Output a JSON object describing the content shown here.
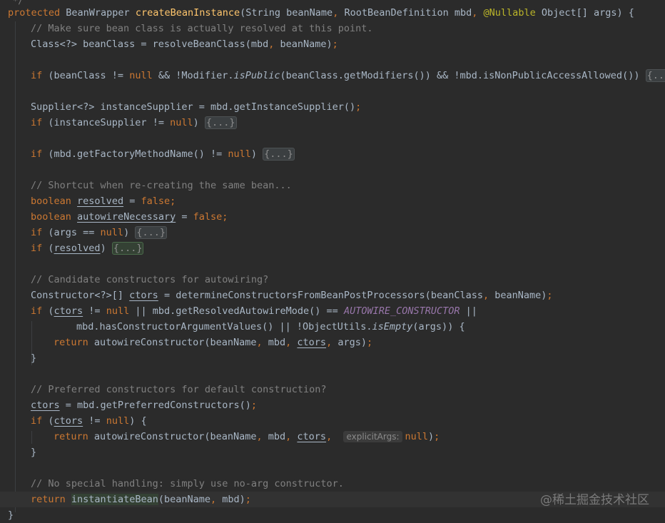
{
  "top_stub": "*/",
  "lines": [
    {
      "id": "signature",
      "indent": 0,
      "current": false,
      "segs": [
        {
          "t": "protected",
          "c": "kw"
        },
        {
          "t": " BeanWrapper "
        },
        {
          "t": "createBeanInstance",
          "c": "fn"
        },
        {
          "t": "(String beanName"
        },
        {
          "t": ",",
          "c": "kw"
        },
        {
          "t": " RootBeanDefinition mbd"
        },
        {
          "t": ",",
          "c": "kw"
        },
        {
          "t": " "
        },
        {
          "t": "@Nullable",
          "c": "an"
        },
        {
          "t": " Object[] args) {"
        }
      ]
    },
    {
      "id": "comment-resolve",
      "indent": 43,
      "segs": [
        {
          "t": "// Make sure bean class is actually resolved at this point.",
          "c": "cm"
        }
      ]
    },
    {
      "id": "bean-class",
      "indent": 43,
      "segs": [
        {
          "t": "Class<?> beanClass = resolveBeanClass(mbd"
        },
        {
          "t": ",",
          "c": "kw"
        },
        {
          "t": " beanName)"
        },
        {
          "t": ";",
          "c": "kw"
        }
      ]
    },
    {
      "id": "blank-1",
      "indent": 0,
      "segs": []
    },
    {
      "id": "if-public",
      "indent": 43,
      "segs": [
        {
          "t": "if",
          "c": "kw"
        },
        {
          "t": " (beanClass != "
        },
        {
          "t": "null",
          "c": "kw"
        },
        {
          "t": " && !Modifier."
        },
        {
          "t": "isPublic",
          "c": "it"
        },
        {
          "t": "(beanClass.getModifiers()) && !mbd.isNonPublicAccessAllowed()) "
        },
        {
          "t": "{...}",
          "c": "fold"
        }
      ]
    },
    {
      "id": "blank-2",
      "indent": 0,
      "segs": []
    },
    {
      "id": "supplier",
      "indent": 43,
      "segs": [
        {
          "t": "Supplier<?> instanceSupplier = mbd.getInstanceSupplier()"
        },
        {
          "t": ";",
          "c": "kw"
        }
      ]
    },
    {
      "id": "if-supplier",
      "indent": 43,
      "segs": [
        {
          "t": "if",
          "c": "kw"
        },
        {
          "t": " (instanceSupplier != "
        },
        {
          "t": "null",
          "c": "kw"
        },
        {
          "t": ") "
        },
        {
          "t": "{...}",
          "c": "fold"
        }
      ]
    },
    {
      "id": "blank-3",
      "indent": 0,
      "segs": []
    },
    {
      "id": "if-factory",
      "indent": 43,
      "segs": [
        {
          "t": "if",
          "c": "kw"
        },
        {
          "t": " (mbd.getFactoryMethodName() != "
        },
        {
          "t": "null",
          "c": "kw"
        },
        {
          "t": ") "
        },
        {
          "t": "{...}",
          "c": "fold"
        }
      ]
    },
    {
      "id": "blank-4",
      "indent": 0,
      "segs": []
    },
    {
      "id": "comment-shortcut",
      "indent": 43,
      "segs": [
        {
          "t": "// Shortcut when re-creating the same bean...",
          "c": "cm"
        }
      ]
    },
    {
      "id": "resolved-decl",
      "indent": 43,
      "segs": [
        {
          "t": "boolean",
          "c": "kw"
        },
        {
          "t": " "
        },
        {
          "t": "resolved",
          "c": "ul"
        },
        {
          "t": " = "
        },
        {
          "t": "false",
          "c": "kw"
        },
        {
          "t": ";",
          "c": "kw"
        }
      ]
    },
    {
      "id": "autowire-decl",
      "indent": 43,
      "segs": [
        {
          "t": "boolean",
          "c": "kw"
        },
        {
          "t": " "
        },
        {
          "t": "autowireNecessary",
          "c": "ul"
        },
        {
          "t": " = "
        },
        {
          "t": "false",
          "c": "kw"
        },
        {
          "t": ";",
          "c": "kw"
        }
      ]
    },
    {
      "id": "if-args",
      "indent": 43,
      "segs": [
        {
          "t": "if",
          "c": "kw"
        },
        {
          "t": " (args == "
        },
        {
          "t": "null",
          "c": "kw"
        },
        {
          "t": ") "
        },
        {
          "t": "{...}",
          "c": "fold"
        }
      ]
    },
    {
      "id": "if-resolved",
      "indent": 43,
      "segs": [
        {
          "t": "if",
          "c": "kw"
        },
        {
          "t": " ("
        },
        {
          "t": "resolved",
          "c": "ul"
        },
        {
          "t": ") "
        },
        {
          "t": "{...}",
          "c": "fold hl"
        }
      ]
    },
    {
      "id": "blank-5",
      "indent": 0,
      "segs": []
    },
    {
      "id": "comment-candidate",
      "indent": 43,
      "segs": [
        {
          "t": "// Candidate constructors for autowiring?",
          "c": "cm"
        }
      ]
    },
    {
      "id": "ctors-decl",
      "indent": 43,
      "segs": [
        {
          "t": "Constructor<?>[] "
        },
        {
          "t": "ctors",
          "c": "ul"
        },
        {
          "t": " = determineConstructorsFromBeanPostProcessors(beanClass"
        },
        {
          "t": ",",
          "c": "kw"
        },
        {
          "t": " beanName)"
        },
        {
          "t": ";",
          "c": "kw"
        }
      ]
    },
    {
      "id": "if-ctors",
      "indent": 43,
      "segs": [
        {
          "t": "if",
          "c": "kw"
        },
        {
          "t": " ("
        },
        {
          "t": "ctors",
          "c": "ul"
        },
        {
          "t": " != "
        },
        {
          "t": "null",
          "c": "kw"
        },
        {
          "t": " || mbd.getResolvedAutowireMode() == "
        },
        {
          "t": "AUTOWIRE_CONSTRUCTOR",
          "c": "cst"
        },
        {
          "t": " ||"
        }
      ]
    },
    {
      "id": "if-ctors-cont",
      "indent": 107,
      "segs": [
        {
          "t": "mbd.hasConstructorArgumentValues() || !ObjectUtils."
        },
        {
          "t": "isEmpty",
          "c": "it"
        },
        {
          "t": "(args)) {"
        }
      ]
    },
    {
      "id": "return-autowire-1",
      "indent": 75,
      "segs": [
        {
          "t": "return",
          "c": "kw"
        },
        {
          "t": " autowireConstructor(beanName"
        },
        {
          "t": ",",
          "c": "kw"
        },
        {
          "t": " mbd"
        },
        {
          "t": ",",
          "c": "kw"
        },
        {
          "t": " "
        },
        {
          "t": "ctors",
          "c": "ul"
        },
        {
          "t": ",",
          "c": "kw"
        },
        {
          "t": " args)"
        },
        {
          "t": ";",
          "c": "kw"
        }
      ]
    },
    {
      "id": "close-1",
      "indent": 43,
      "segs": [
        {
          "t": "}"
        }
      ]
    },
    {
      "id": "blank-6",
      "indent": 0,
      "segs": []
    },
    {
      "id": "comment-preferred",
      "indent": 43,
      "segs": [
        {
          "t": "// Preferred constructors for default construction?",
          "c": "cm"
        }
      ]
    },
    {
      "id": "ctors-preferred",
      "indent": 43,
      "segs": [
        {
          "t": "ctors",
          "c": "ul"
        },
        {
          "t": " = mbd.getPreferredConstructors()"
        },
        {
          "t": ";",
          "c": "kw"
        }
      ]
    },
    {
      "id": "if-ctors-2",
      "indent": 43,
      "segs": [
        {
          "t": "if",
          "c": "kw"
        },
        {
          "t": " ("
        },
        {
          "t": "ctors",
          "c": "ul"
        },
        {
          "t": " != "
        },
        {
          "t": "null",
          "c": "kw"
        },
        {
          "t": ") {"
        }
      ]
    },
    {
      "id": "return-autowire-2",
      "indent": 75,
      "segs": [
        {
          "t": "return",
          "c": "kw"
        },
        {
          "t": " autowireConstructor(beanName"
        },
        {
          "t": ",",
          "c": "kw"
        },
        {
          "t": " mbd"
        },
        {
          "t": ",",
          "c": "kw"
        },
        {
          "t": " "
        },
        {
          "t": "ctors",
          "c": "ul"
        },
        {
          "t": ",",
          "c": "kw"
        },
        {
          "t": "  "
        },
        {
          "t": "explicitArgs:",
          "c": "hint"
        },
        {
          "t": "null",
          "c": "kw"
        },
        {
          "t": ")"
        },
        {
          "t": ";",
          "c": "kw"
        }
      ]
    },
    {
      "id": "close-2",
      "indent": 43,
      "segs": [
        {
          "t": "}"
        }
      ]
    },
    {
      "id": "blank-7",
      "indent": 0,
      "segs": []
    },
    {
      "id": "comment-no-special",
      "indent": 43,
      "segs": [
        {
          "t": "// No special handling: simply use no-arg constructor.",
          "c": "cm"
        }
      ]
    },
    {
      "id": "return-instantiate",
      "indent": 43,
      "current": true,
      "segs": [
        {
          "t": "return",
          "c": "kw"
        },
        {
          "t": " "
        },
        {
          "t": "instantiateBean",
          "c": "hl-bg"
        },
        {
          "t": "(beanName"
        },
        {
          "t": ",",
          "c": "kw"
        },
        {
          "t": " mbd)"
        },
        {
          "t": ";",
          "c": "kw"
        }
      ]
    },
    {
      "id": "close-method",
      "indent": 11,
      "segs": [
        {
          "t": "}"
        }
      ]
    }
  ],
  "watermark": "@稀土掘金技术社区"
}
